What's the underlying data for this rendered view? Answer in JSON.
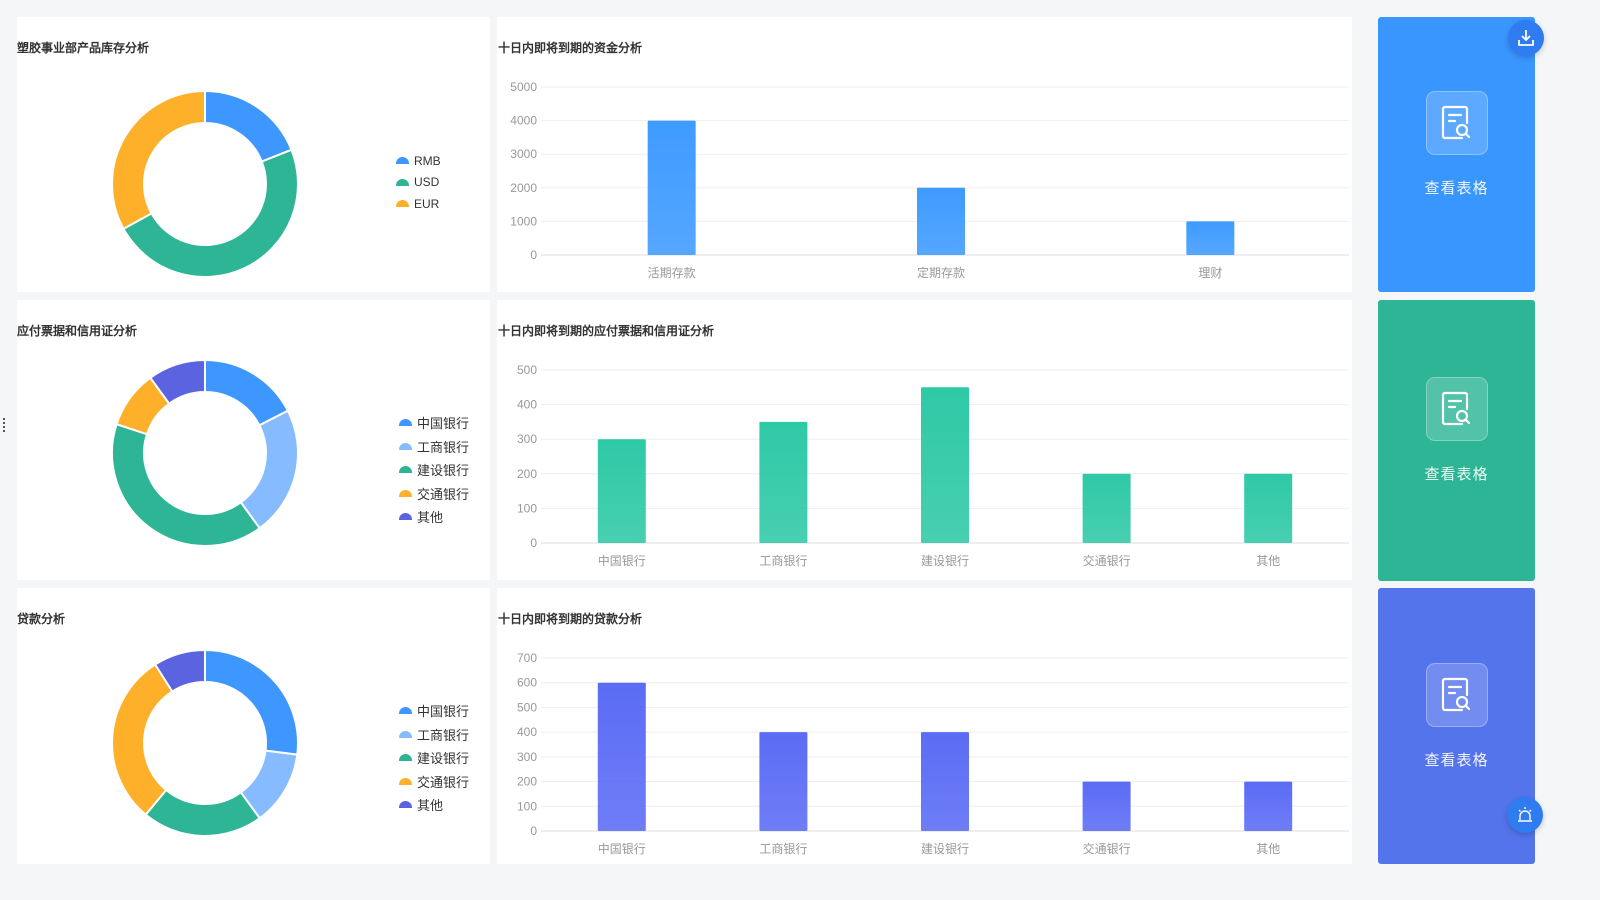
{
  "card_label": "查看表格",
  "rows": [
    {
      "pie": {
        "title": "塑胶事业部产品库存分析",
        "labels": [
          "RMB",
          "USD",
          "EUR"
        ],
        "values": [
          19,
          48,
          33
        ],
        "colors": [
          "#3e97ff",
          "#2db595",
          "#ffb02b"
        ]
      },
      "bar": {
        "title": "十日内即将到期的资金分析",
        "categories": [
          "活期存款",
          "定期存款",
          "理财"
        ],
        "values": [
          4000,
          2000,
          1000
        ],
        "ylim": [
          0,
          5000
        ],
        "step": 1000,
        "color": "#3e9bff"
      },
      "card_color": "#3a96ff"
    },
    {
      "pie": {
        "title": "应付票据和信用证分析",
        "labels": [
          "中国银行",
          "工商银行",
          "建设银行",
          "交通银行",
          "其他"
        ],
        "values": [
          17.5,
          22.5,
          40,
          10,
          10
        ],
        "colors": [
          "#3e97ff",
          "#86bcff",
          "#2db595",
          "#ffb02b",
          "#5b63e0"
        ]
      },
      "bar": {
        "title": "十日内即将到期的应付票据和信用证分析",
        "categories": [
          "中国银行",
          "工商银行",
          "建设银行",
          "交通银行",
          "其他"
        ],
        "values": [
          300,
          350,
          450,
          200,
          200
        ],
        "ylim": [
          0,
          500
        ],
        "step": 100,
        "color": "#2ec9a6"
      },
      "card_color": "#2db595"
    },
    {
      "pie": {
        "title": "贷款分析",
        "labels": [
          "中国银行",
          "工商银行",
          "建设银行",
          "交通银行",
          "其他"
        ],
        "values": [
          27,
          13,
          21,
          30,
          9
        ],
        "colors": [
          "#3e97ff",
          "#86bcff",
          "#2db595",
          "#ffb02b",
          "#5b63e0"
        ]
      },
      "bar": {
        "title": "十日内即将到期的贷款分析",
        "categories": [
          "中国银行",
          "工商银行",
          "建设银行",
          "交通银行",
          "其他"
        ],
        "values": [
          600,
          400,
          400,
          200,
          200
        ],
        "ylim": [
          0,
          700
        ],
        "step": 100,
        "color": "#5b6cf5"
      },
      "card_color": "#5474ec"
    }
  ]
}
